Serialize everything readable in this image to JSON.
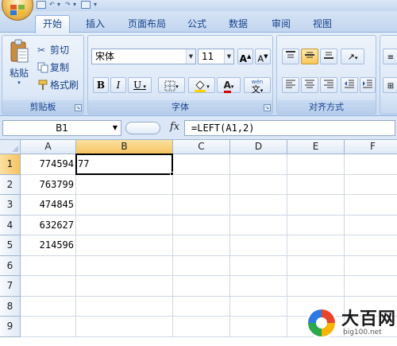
{
  "ribbon_tabs": [
    "开始",
    "插入",
    "页面布局",
    "公式",
    "数据",
    "审阅",
    "视图"
  ],
  "active_tab": "开始",
  "clipboard": {
    "paste_label": "粘贴",
    "cut_label": "剪切",
    "copy_label": "复制",
    "format_painter_label": "格式刷",
    "group_label": "剪贴板"
  },
  "font": {
    "font_name": "宋体",
    "font_size": "11",
    "grow_label": "A",
    "shrink_label": "A",
    "bold_label": "B",
    "italic_label": "I",
    "underline_label": "U",
    "font_color_label": "A",
    "phonetic_label": "wén",
    "phonetic_char": "文",
    "group_label": "字体",
    "fill_color": "#ffd200",
    "font_color": "#d40000"
  },
  "alignment": {
    "group_label": "对齐方式"
  },
  "formula_bar": {
    "name_box": "B1",
    "fx_label": "fx",
    "formula": "=LEFT(A1,2)"
  },
  "grid": {
    "columns": [
      "A",
      "B",
      "C",
      "D",
      "E",
      "F"
    ],
    "rows": [
      "1",
      "2",
      "3",
      "4",
      "5",
      "6",
      "7",
      "8",
      "9"
    ],
    "selected_cell": "B1",
    "cells": {
      "A1": "774594",
      "A2": "763799",
      "A3": "474845",
      "A4": "632627",
      "A5": "214596",
      "B1": "77"
    }
  },
  "watermark": {
    "brand": "大百网",
    "url": "big100.net"
  },
  "colors": {
    "accent": "#15428b",
    "selection": "#f6c463"
  }
}
